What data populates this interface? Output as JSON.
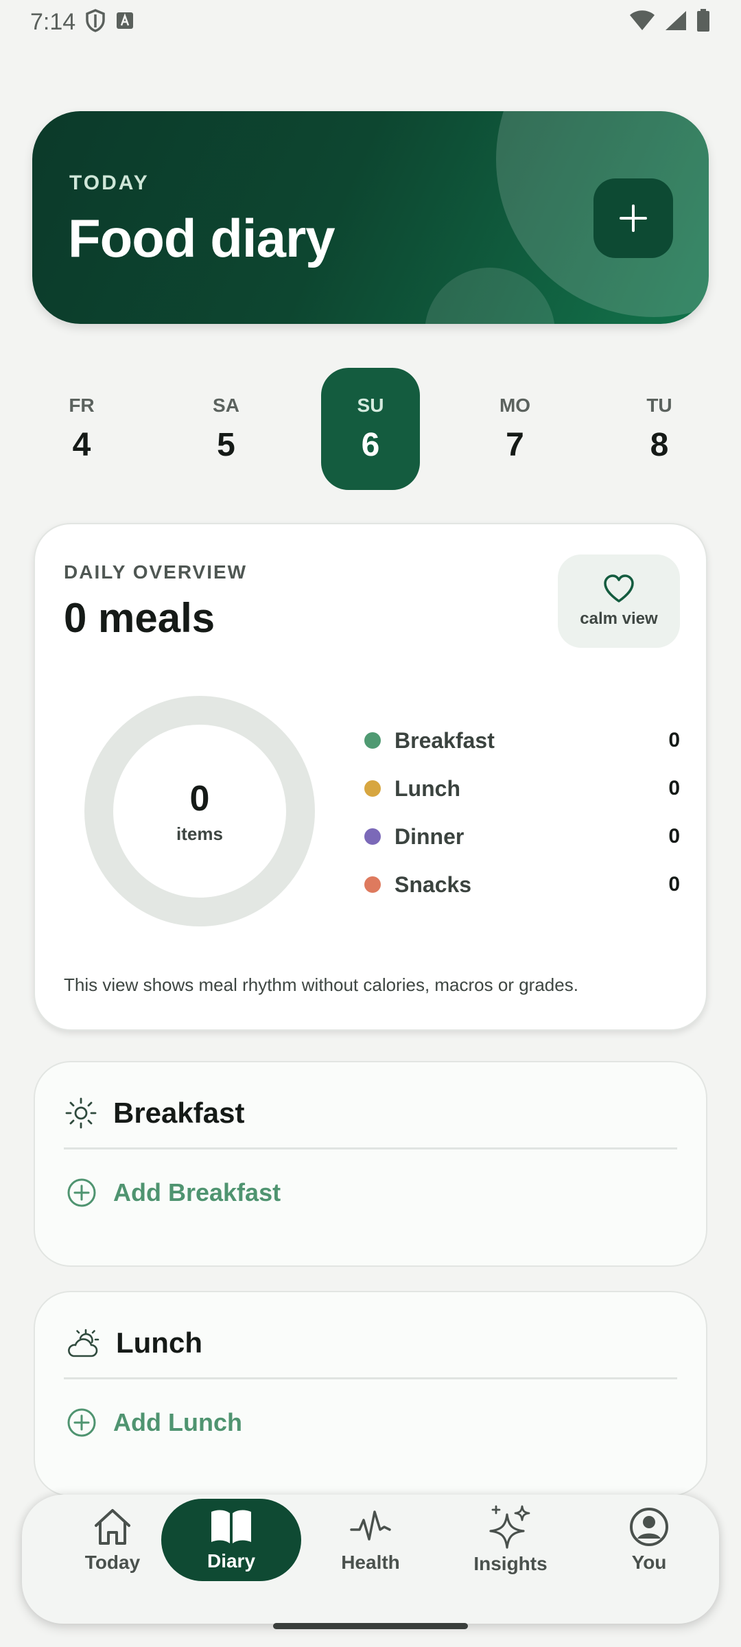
{
  "status": {
    "time": "7:14"
  },
  "hero": {
    "eyebrow": "TODAY",
    "title": "Food diary",
    "add_icon": "plus-icon"
  },
  "days": [
    {
      "abbr": "FR",
      "num": "4",
      "selected": false
    },
    {
      "abbr": "SA",
      "num": "5",
      "selected": false
    },
    {
      "abbr": "SU",
      "num": "6",
      "selected": true
    },
    {
      "abbr": "MO",
      "num": "7",
      "selected": false
    },
    {
      "abbr": "TU",
      "num": "8",
      "selected": false
    }
  ],
  "overview": {
    "eyebrow": "DAILY OVERVIEW",
    "title": "0 meals",
    "calm_label": "calm view",
    "donut_count": "0",
    "donut_label": "items",
    "legend": [
      {
        "label": "Breakfast",
        "value": "0",
        "color": "#4f9a72"
      },
      {
        "label": "Lunch",
        "value": "0",
        "color": "#d7a640"
      },
      {
        "label": "Dinner",
        "value": "0",
        "color": "#7b69b8"
      },
      {
        "label": "Snacks",
        "value": "0",
        "color": "#de7a5e"
      }
    ],
    "note": "This view shows meal rhythm without calories, macros or grades."
  },
  "meals": [
    {
      "title": "Breakfast",
      "add_label": "Add Breakfast",
      "icon": "sun-icon"
    },
    {
      "title": "Lunch",
      "add_label": "Add Lunch",
      "icon": "partly-cloudy-icon"
    }
  ],
  "nav": [
    {
      "label": "Today",
      "icon": "home-icon",
      "active": false
    },
    {
      "label": "Diary",
      "icon": "book-icon",
      "active": true
    },
    {
      "label": "Health",
      "icon": "pulse-icon",
      "active": false
    },
    {
      "label": "Insights",
      "icon": "sparkle-icon",
      "active": false
    },
    {
      "label": "You",
      "icon": "account-icon",
      "active": false
    }
  ],
  "colors": {
    "brand_dark": "#0f4a33",
    "brand_accent": "#4f9470",
    "background": "#f3f4f2"
  }
}
